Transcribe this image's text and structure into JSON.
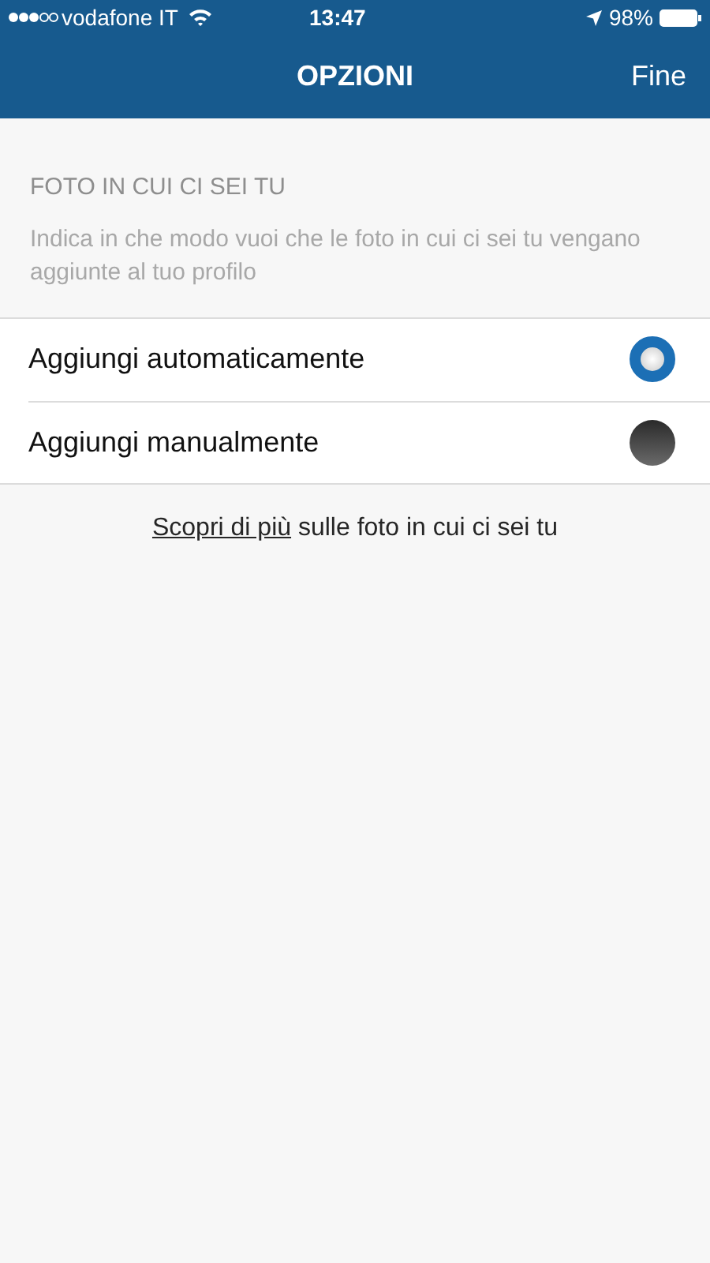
{
  "status_bar": {
    "carrier": "vodafone IT",
    "time": "13:47",
    "battery": "98%"
  },
  "nav_bar": {
    "title": "OPZIONI",
    "done": "Fine"
  },
  "section": {
    "header": "FOTO IN CUI CI SEI TU",
    "description": "Indica in che modo vuoi che le foto in cui ci sei tu vengano aggiunte al tuo profilo"
  },
  "options": [
    {
      "label": "Aggiungi automaticamente",
      "selected": true
    },
    {
      "label": "Aggiungi manualmente",
      "selected": false
    }
  ],
  "footer": {
    "link": "Scopri di più",
    "text": "sulle foto in cui ci sei tu"
  }
}
